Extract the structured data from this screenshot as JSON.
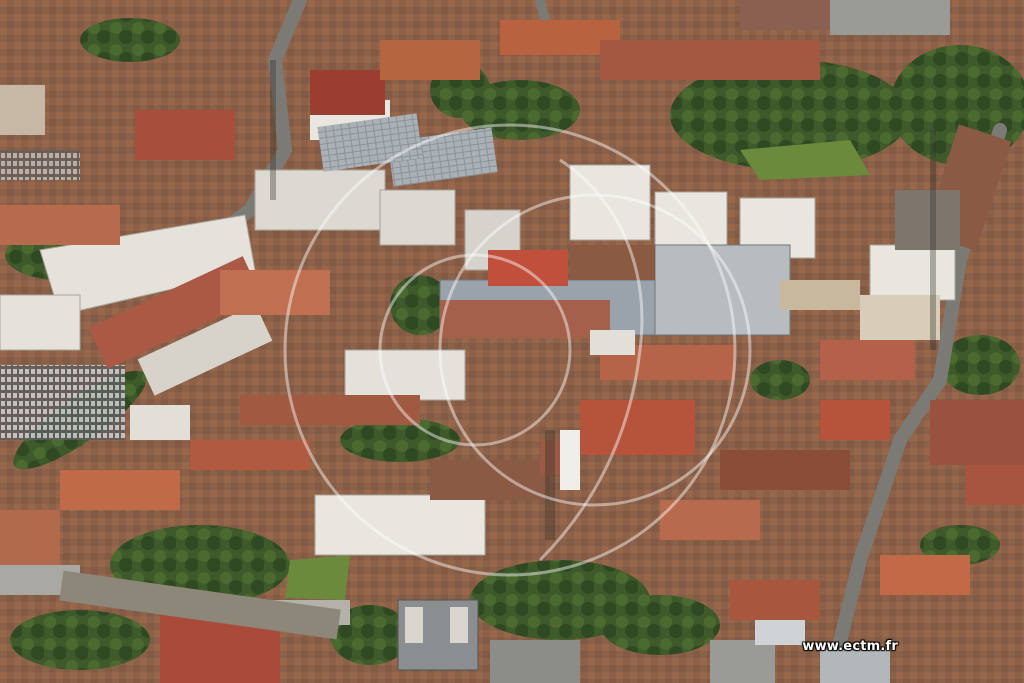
{
  "photo": {
    "subject": "aerial-view-dense-town",
    "palette": {
      "roof_red": "#b5543a",
      "roof_orange": "#c8693f",
      "roof_grey": "#6e7478",
      "roof_light": "#d9d6cf",
      "tree_green": "#3e5a2a",
      "tree_dark": "#2c4220",
      "lawn": "#6c8a3c",
      "court_red": "#c0503c",
      "road": "#7b7a74",
      "white_facade": "#e9e6df"
    }
  },
  "watermark": {
    "text": "www.ectm.fr",
    "circle_color": "#ffffff"
  }
}
